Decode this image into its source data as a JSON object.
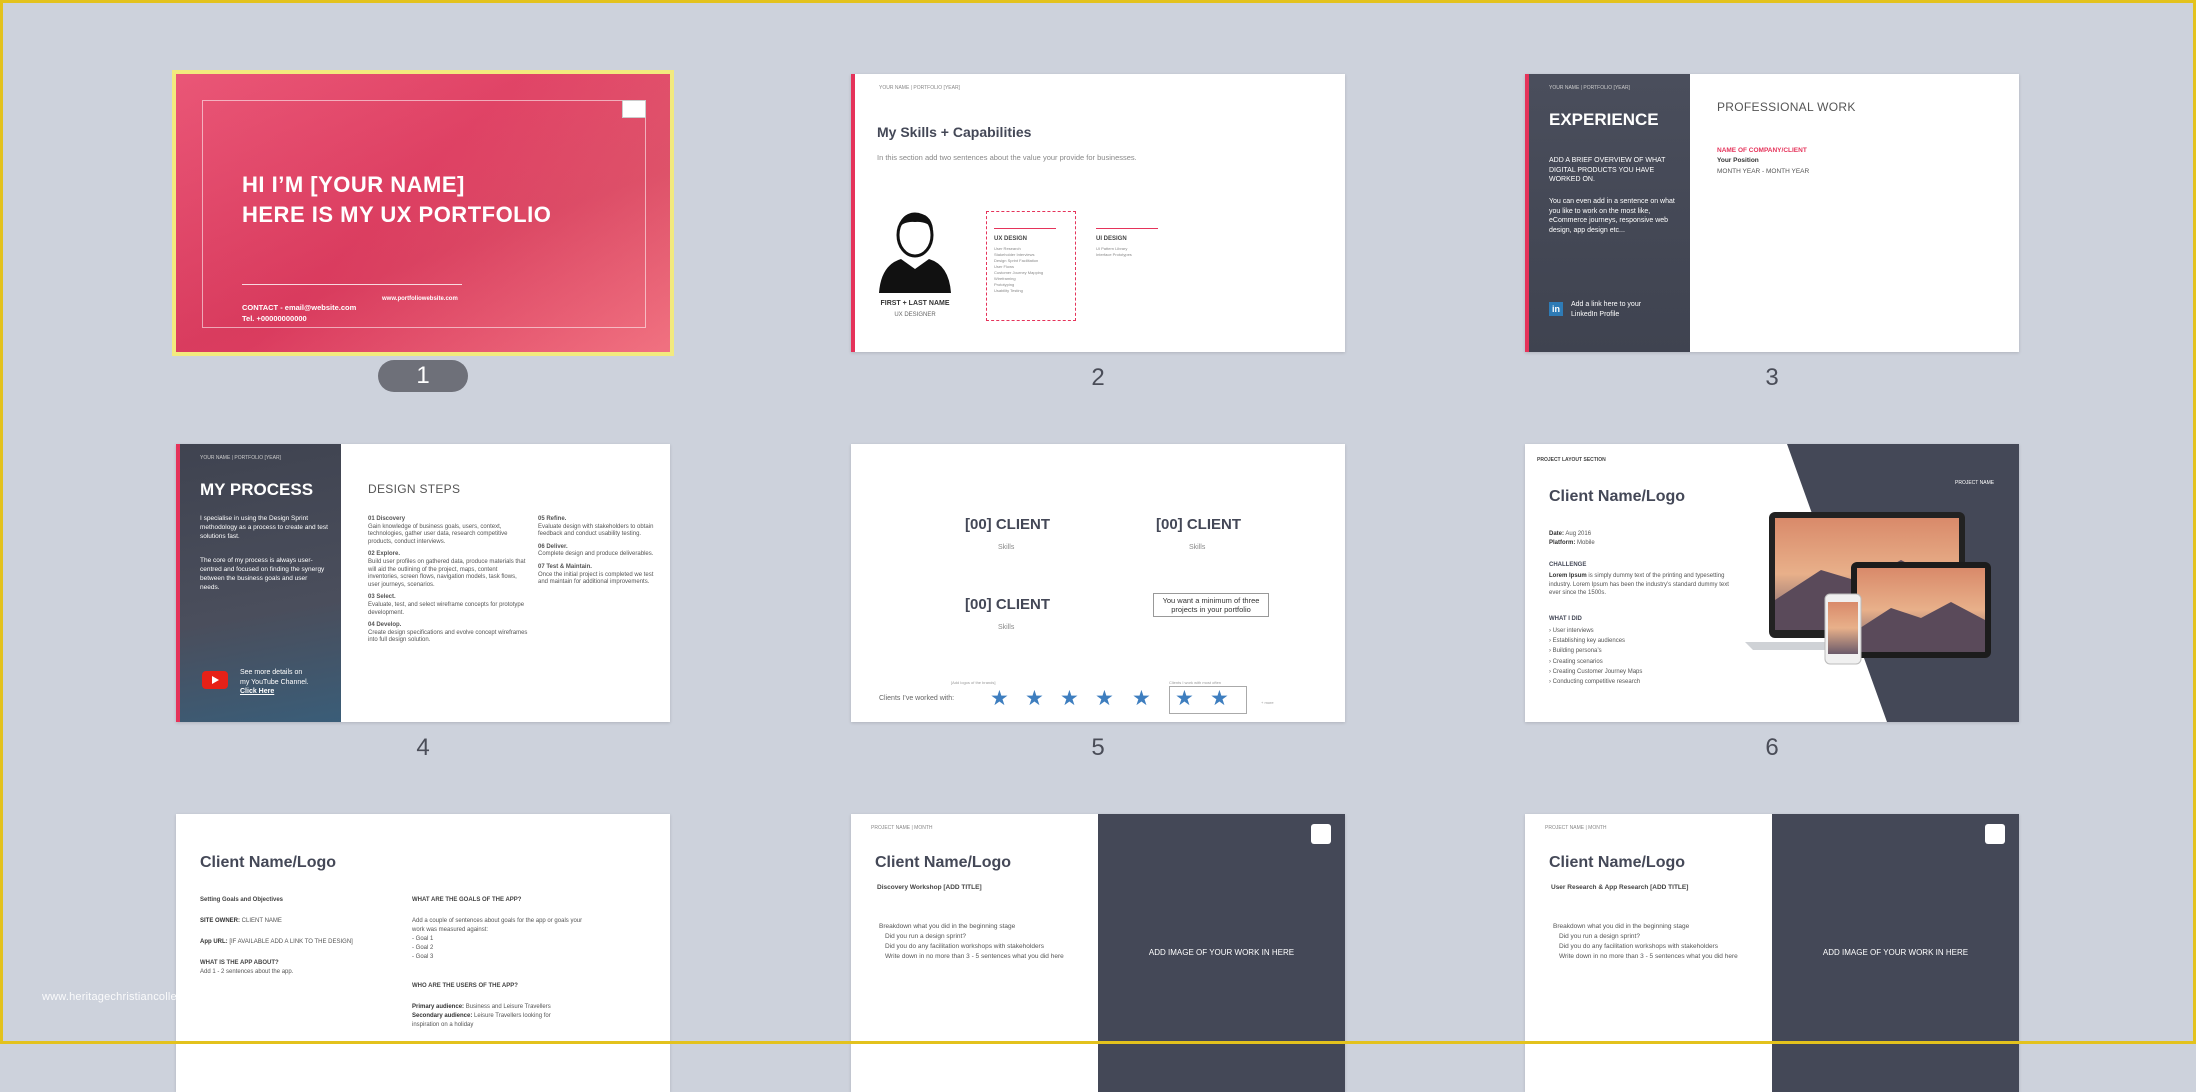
{
  "watermark": "www.heritagechristiancollege.com",
  "slide_numbers": [
    "1",
    "2",
    "3",
    "4",
    "5",
    "6"
  ],
  "slide1": {
    "line1": "HI I’M [YOUR NAME]",
    "line2": "HERE IS MY UX PORTFOLIO",
    "contact": "CONTACT - email@website.com",
    "tel": "Tel. +00000000000",
    "website": "www.portfoliowebsite.com"
  },
  "slide2": {
    "header": "YOUR NAME | PORTFOLIO [YEAR]",
    "title": "My Skills + Capabilities",
    "subtitle": "In this section add two sentences about the value your provide for businesses.",
    "name": "FIRST + LAST NAME",
    "role": "UX DESIGNER",
    "col1_title": "UX DESIGN",
    "col1_items": [
      "User Research",
      "Stakeholder Interviews",
      "Design Sprint Facilitation",
      "User Flows",
      "Customer Journey Mapping",
      "Wireframing",
      "Prototyping",
      "Usability Testing"
    ],
    "col2_title": "UI DESIGN",
    "col2_items": [
      "UI Pattern Library",
      "Interface Prototypes"
    ]
  },
  "slide3": {
    "header": "YOUR NAME | PORTFOLIO [YEAR]",
    "title": "EXPERIENCE",
    "p1": "ADD A BRIEF OVERVIEW OF WHAT DIGITAL PRODUCTS YOU HAVE WORKED ON.",
    "p2": "You can even add in a sentence on what you like to work on the most like, eCommerce journeys, responsive web design, app design etc...",
    "linkedin": "Add a link here to your LinkedIn Profile",
    "right_title": "PROFESSIONAL WORK",
    "company": "NAME OF COMPANY/CLIENT",
    "position": "Your Position",
    "dates": "MONTH YEAR - MONTH YEAR"
  },
  "slide4": {
    "header": "YOUR NAME | PORTFOLIO [YEAR]",
    "title": "MY PROCESS",
    "p1": "I specialise in using the Design Sprint methodology as a process to create and test solutions fast.",
    "p2": "The core of my process is always user-centred and focused on finding the synergy between the business goals and user needs.",
    "yt1": "See more details on",
    "yt2": "my YouTube Channel.",
    "yt3": "Click Here",
    "steps_title": "DESIGN STEPS",
    "steps_left": [
      {
        "t": "01 Discovery",
        "d": "Gain knowledge of business goals, users, context, technologies, gather user data, research competitive products, conduct interviews."
      },
      {
        "t": "02 Explore.",
        "d": "Build user profiles on gathered data, produce materials that will aid the outlining of the project, maps, content inventories, screen flows, navigation models, task flows, user journeys, scenarios."
      },
      {
        "t": "03 Select.",
        "d": "Evaluate, test, and select wireframe concepts for prototype development."
      },
      {
        "t": "04 Develop.",
        "d": "Create design specifications and evolve concept wireframes into full design solution."
      }
    ],
    "steps_right": [
      {
        "t": "05 Refine.",
        "d": "Evaluate design with stakeholders to obtain feedback and conduct usability testing."
      },
      {
        "t": "06 Deliver.",
        "d": "Complete design and produce deliverables."
      },
      {
        "t": "07 Test & Maintain.",
        "d": "Once the initial project is completed we test and maintain for additional improvements."
      }
    ]
  },
  "slide5": {
    "client": "[00] CLIENT",
    "skills": "Skills",
    "note": "You want a minimum of three projects in your portfolio",
    "clients_label": "Clients I’ve worked with:",
    "stars_note_left": "[Add logos of the brands]",
    "stars_note_right": "Clients I work with most often",
    "more": "+ more"
  },
  "slide6": {
    "section": "PROJECT LAYOUT SECTION",
    "project_name": "PROJECT NAME",
    "title": "Client Name/Logo",
    "date_label": "Date:",
    "date": "Aug 2016",
    "platform_label": "Platform:",
    "platform": "Mobile",
    "challenge_title": "CHALLENGE",
    "challenge_lead": "Lorem Ipsum",
    "challenge": "is simply dummy text of the printing and typesetting industry. Lorem Ipsum has been the industry’s standard dummy text ever since the 1500s.",
    "what_title": "WHAT I DID",
    "what_items": [
      "User interviews",
      "Establishing key audiences",
      "Building persona’s",
      "Creating scenarios",
      "Creating Customer Journey Maps",
      "Conducting competitive research"
    ]
  },
  "slide7": {
    "title": "Client Name/Logo",
    "s1": "Setting Goals and Objectives",
    "owner_label": "SITE OWNER:",
    "owner": "CLIENT NAME",
    "url_label": "App URL:",
    "url": "[IF AVAILABLE ADD A LINK TO THE DESIGN]",
    "what_title": "WHAT IS THE APP ABOUT?",
    "what": "Add 1 - 2 sentences about the app.",
    "goals_title": "WHAT ARE THE GOALS OF THE APP?",
    "goals_intro": "Add a couple of sentences about goals for the app or goals your work was measured against:",
    "goals": [
      "- Goal 1",
      "- Goal 2",
      "- Goal 3"
    ],
    "users_title": "WHO ARE THE USERS OF THE APP?",
    "primary_label": "Primary audience:",
    "primary": "Business and Leisure Travellers",
    "secondary_label": "Secondary audience:",
    "secondary": "Leisure Travellers looking for",
    "secondary2": "inspiration on a holiday"
  },
  "slide8": {
    "header": "PROJECT NAME | MONTH",
    "title": "Client Name/Logo",
    "subtitle": "Discovery Workshop [ADD TITLE]",
    "b1": "Breakdown what you did in the beginning stage",
    "b2": "Did you run a design sprint?",
    "b3": "Did you do any facilitation workshops with stakeholders",
    "b4": "Write down in no more than 3 - 5 sentences what you did here",
    "image": "ADD IMAGE OF YOUR WORK IN HERE"
  },
  "slide9": {
    "header": "PROJECT NAME | MONTH",
    "title": "Client Name/Logo",
    "subtitle": "User Research & App Research [ADD TITLE]",
    "b1": "Breakdown what you did in the beginning stage",
    "b2": "Did you run a design sprint?",
    "b3": "Did you do any facilitation workshops with stakeholders",
    "b4": "Write down in no more than 3 - 5 sentences what you did here",
    "image": "ADD IMAGE OF YOUR WORK IN HERE"
  },
  "colors": {
    "accent": "#e5335a",
    "dark": "#444857",
    "background": "#cdd2dc",
    "selection": "#f2ea7e",
    "star": "#3e7ebf"
  }
}
